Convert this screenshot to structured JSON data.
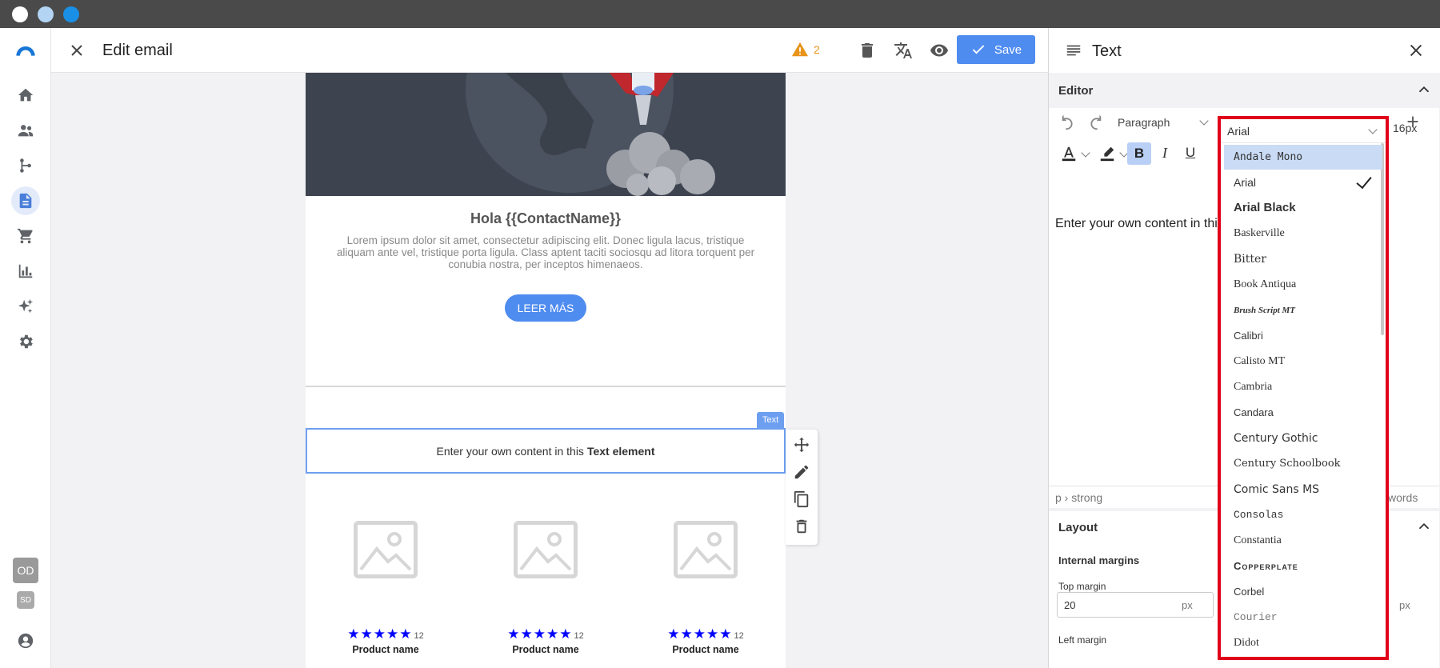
{
  "header": {
    "title": "Edit email",
    "warning_count": "2",
    "save_label": "Save"
  },
  "rail": {
    "avatar_primary": "OD",
    "avatar_secondary": "SD"
  },
  "canvas": {
    "greeting": "Hola {{ContactName}}",
    "lorem": "Lorem ipsum dolor sit amet, consectetur adipiscing elit. Donec ligula lacus, tristique aliquam ante vel, tristique porta ligula. Class aptent taciti sociosqu ad litora torquent per conubia nostra, per inceptos himenaeos.",
    "cta_label": "LEER MÁS",
    "text_tag": "Text",
    "text_element_prefix": "Enter your own content in this",
    "text_element_bold": "Text element",
    "products": [
      {
        "name": "Product name",
        "rating": 5,
        "reviews": "12"
      },
      {
        "name": "Product name",
        "rating": 5,
        "reviews": "12"
      },
      {
        "name": "Product name",
        "rating": 5,
        "reviews": "12"
      }
    ]
  },
  "panel": {
    "title": "Text",
    "editor_section": "Editor",
    "block_format": "Paragraph",
    "font_family": "Arial",
    "font_size": "16px",
    "content_preview": "Enter your own content in thi",
    "element_path": "p › strong",
    "word_count_tail": "words",
    "layout_section": "Layout",
    "internal_margins": "Internal margins",
    "top_margin_label": "Top margin",
    "top_margin_value": "20",
    "unit": "px",
    "left_margin_label": "Left margin"
  },
  "font_dropdown": {
    "selected": "Arial",
    "highlighted": "Andale Mono",
    "options": [
      "Andale Mono",
      "Arial",
      "Arial Black",
      "Baskerville",
      "Bitter",
      "Book Antiqua",
      "Brush Script MT",
      "Calibri",
      "Calisto MT",
      "Cambria",
      "Candara",
      "Century Gothic",
      "Century Schoolbook",
      "Comic Sans MS",
      "Consolas",
      "Constantia",
      "Copperplate",
      "Corbel",
      "Courier",
      "Didot"
    ]
  },
  "colors": {
    "accent": "#4f8cf0",
    "warning": "#e8941a",
    "dropdown_outline": "#e0001a",
    "star": "#0000ff"
  }
}
